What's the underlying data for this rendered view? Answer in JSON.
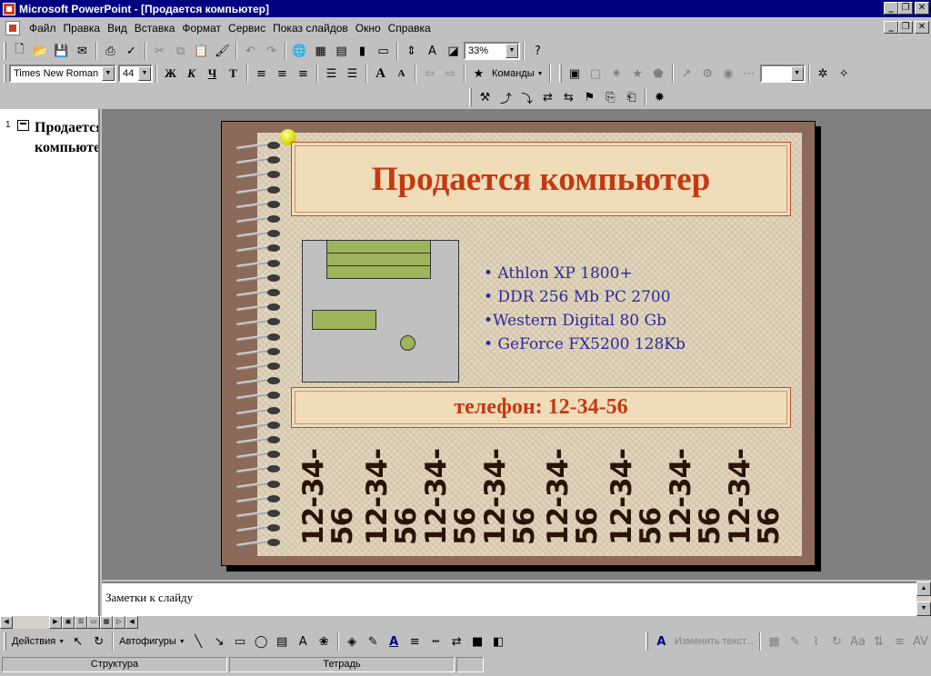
{
  "window": {
    "title": "Microsoft PowerPoint - [Продается компьютер]"
  },
  "menu": [
    "Файл",
    "Правка",
    "Вид",
    "Вставка",
    "Формат",
    "Сервис",
    "Показ слайдов",
    "Окно",
    "Справка"
  ],
  "toolbar_standard": {
    "zoom": "33%"
  },
  "toolbar_formatting": {
    "font_name": "Times New Roman",
    "font_size": "44",
    "bold": "Ж",
    "italic": "К",
    "underline": "Ч",
    "shadow": "Т",
    "commands_label": "Команды"
  },
  "outline": {
    "slide_number": "1",
    "title_text": "Продается\nкомпьютер"
  },
  "slide": {
    "title": "Продается компьютер",
    "bullets": [
      "• Athlon XP 1800+",
      "• DDR 256 Mb  PC 2700",
      "•Western Digital 80 Gb",
      "• GeForce FX5200 128Kb"
    ],
    "phone_line": "телефон: 12-34-56",
    "tabs": [
      "12-34-56",
      "12-34-56",
      "12-34-56",
      "12-34-56",
      "12-34-56",
      "12-34-56",
      "12-34-56",
      "12-34-56"
    ],
    "colors": {
      "title": "#c33a12",
      "bullets": "#2a2a9a",
      "frame": "#8b6a5a",
      "paper": "#e2d6bf"
    }
  },
  "notes": {
    "placeholder": "Заметки к слайду"
  },
  "drawing_toolbar": {
    "actions": "Действия",
    "autoshapes": "Автофигуры",
    "edit_text": "Изменить текст..."
  },
  "status": {
    "view": "Структура",
    "design": "Тетрадь"
  }
}
